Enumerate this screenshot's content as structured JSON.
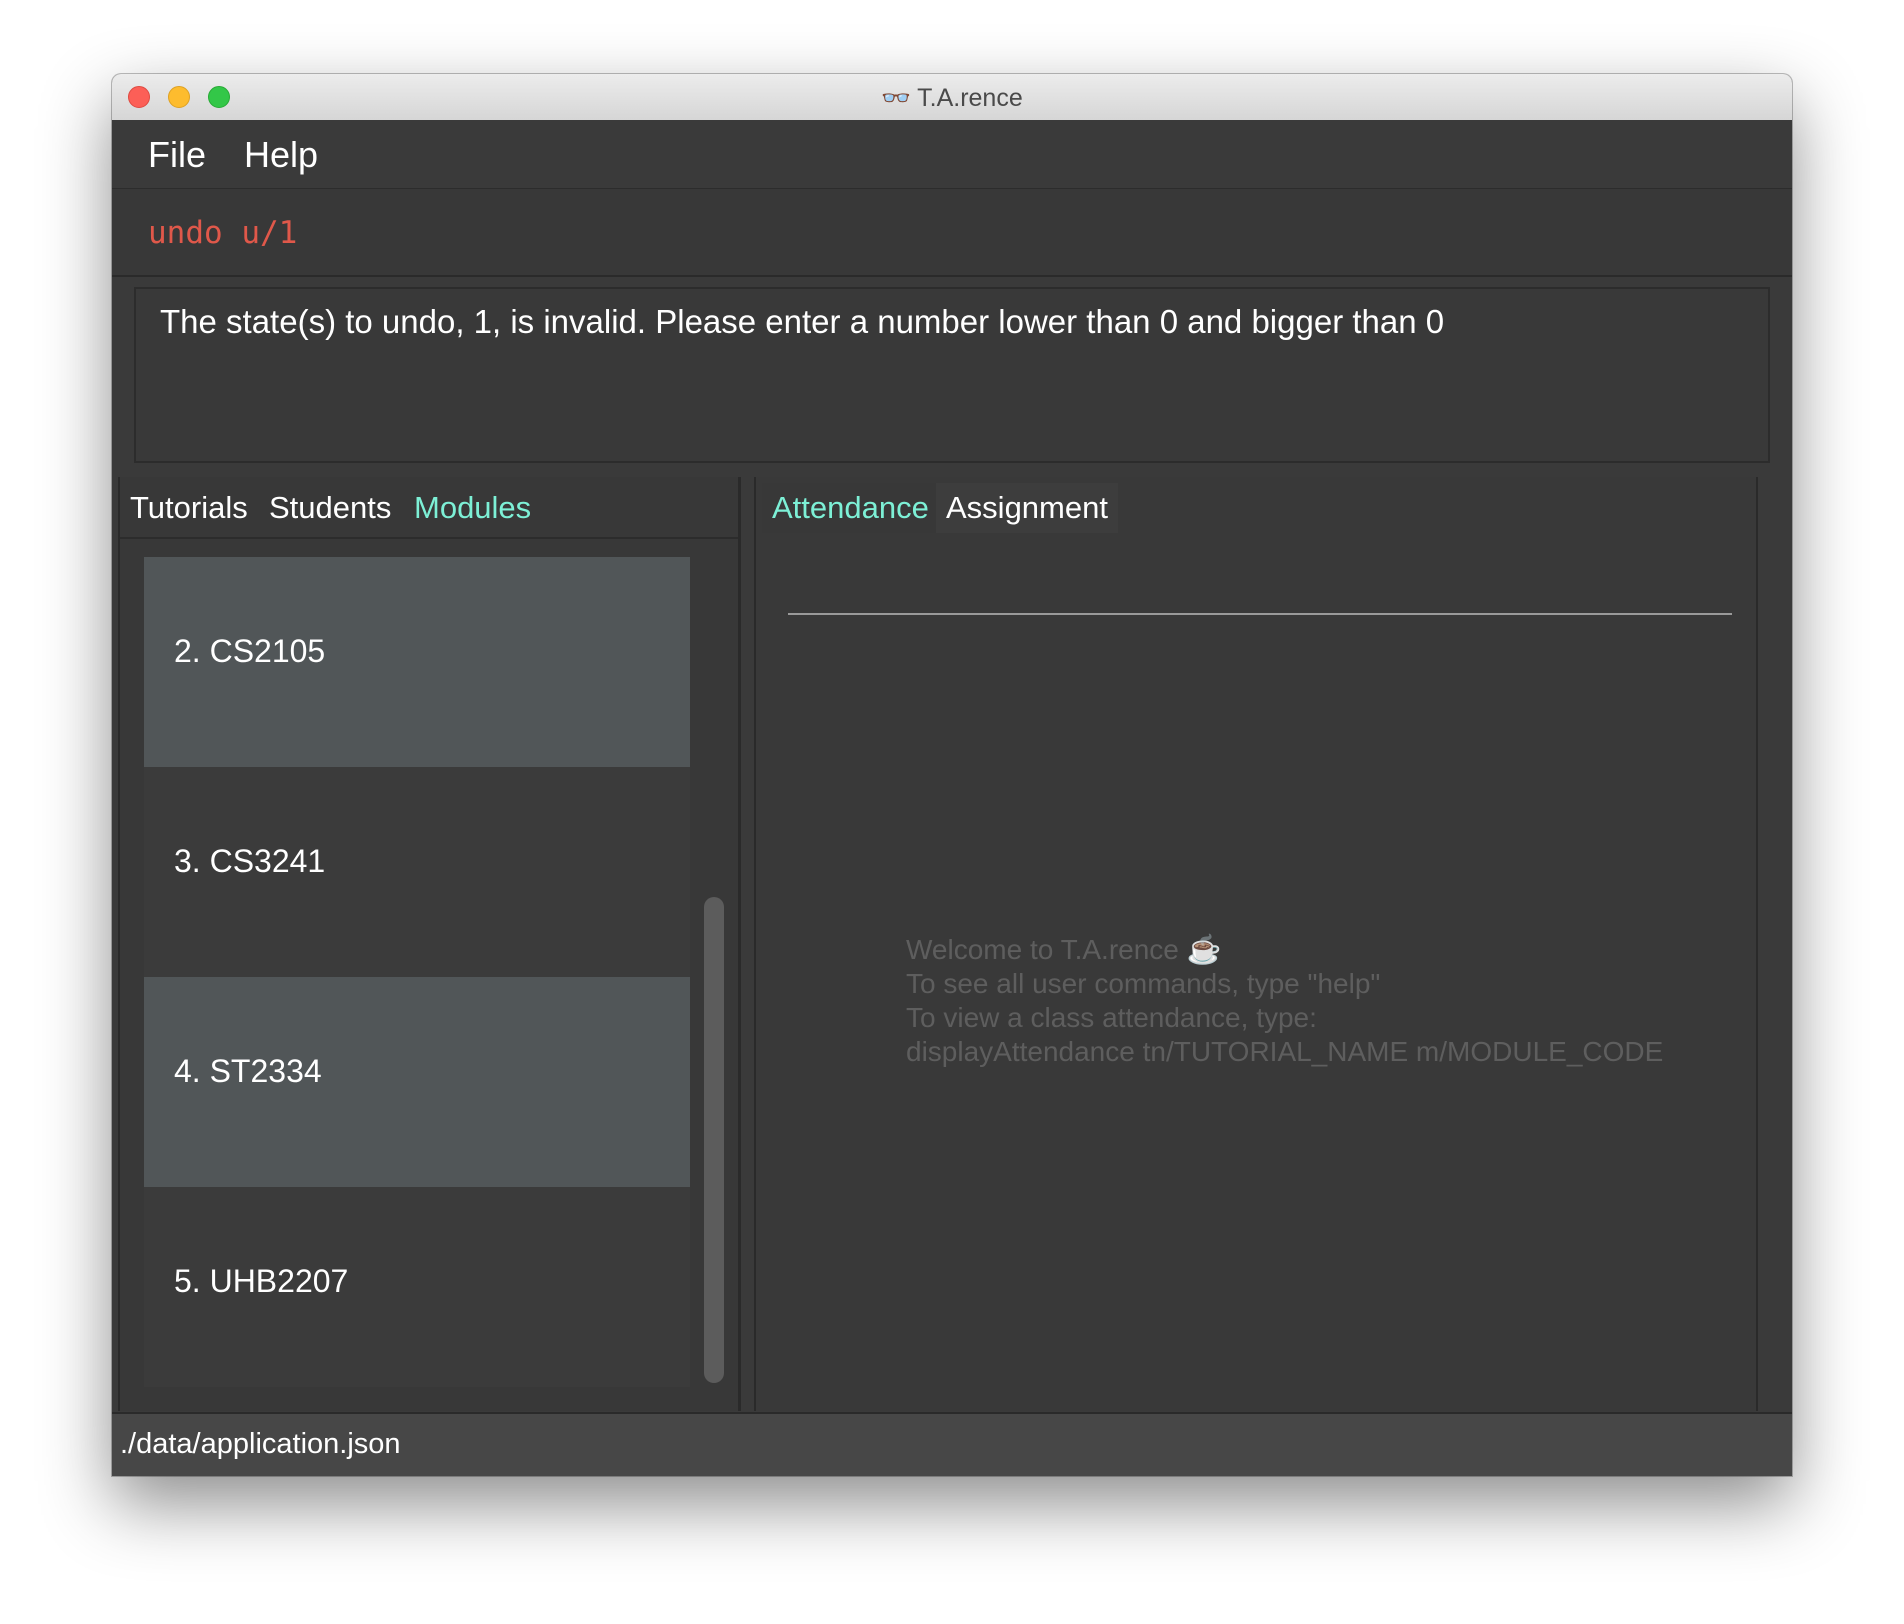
{
  "window": {
    "title": "T.A.rence",
    "title_icon": "👓"
  },
  "menu": {
    "file": "File",
    "help": "Help"
  },
  "command": {
    "value": "undo u/1"
  },
  "result": {
    "message": "The state(s) to undo, 1, is invalid. Please enter a number lower than 0 and bigger than 0"
  },
  "left_tabs": {
    "tutorials": "Tutorials",
    "students": "Students",
    "modules": "Modules"
  },
  "modules": [
    {
      "label": "2.  CS2105"
    },
    {
      "label": "3.  CS3241"
    },
    {
      "label": "4.  ST2334"
    },
    {
      "label": "5.  UHB2207"
    }
  ],
  "right_tabs": {
    "attendance": "Attendance",
    "assignment": "Assignment"
  },
  "placeholder": {
    "line1": "Welcome to T.A.rence ☕",
    "line2": "To see all user commands, type \"help\"",
    "line3": "To view a class attendance, type:",
    "line4": "displayAttendance tn/TUTORIAL_NAME m/MODULE_CODE"
  },
  "status": {
    "path": "./data/application.json"
  },
  "colors": {
    "accent": "#7df0d6",
    "command_text": "#e0584a",
    "background": "#3a3a3a"
  }
}
